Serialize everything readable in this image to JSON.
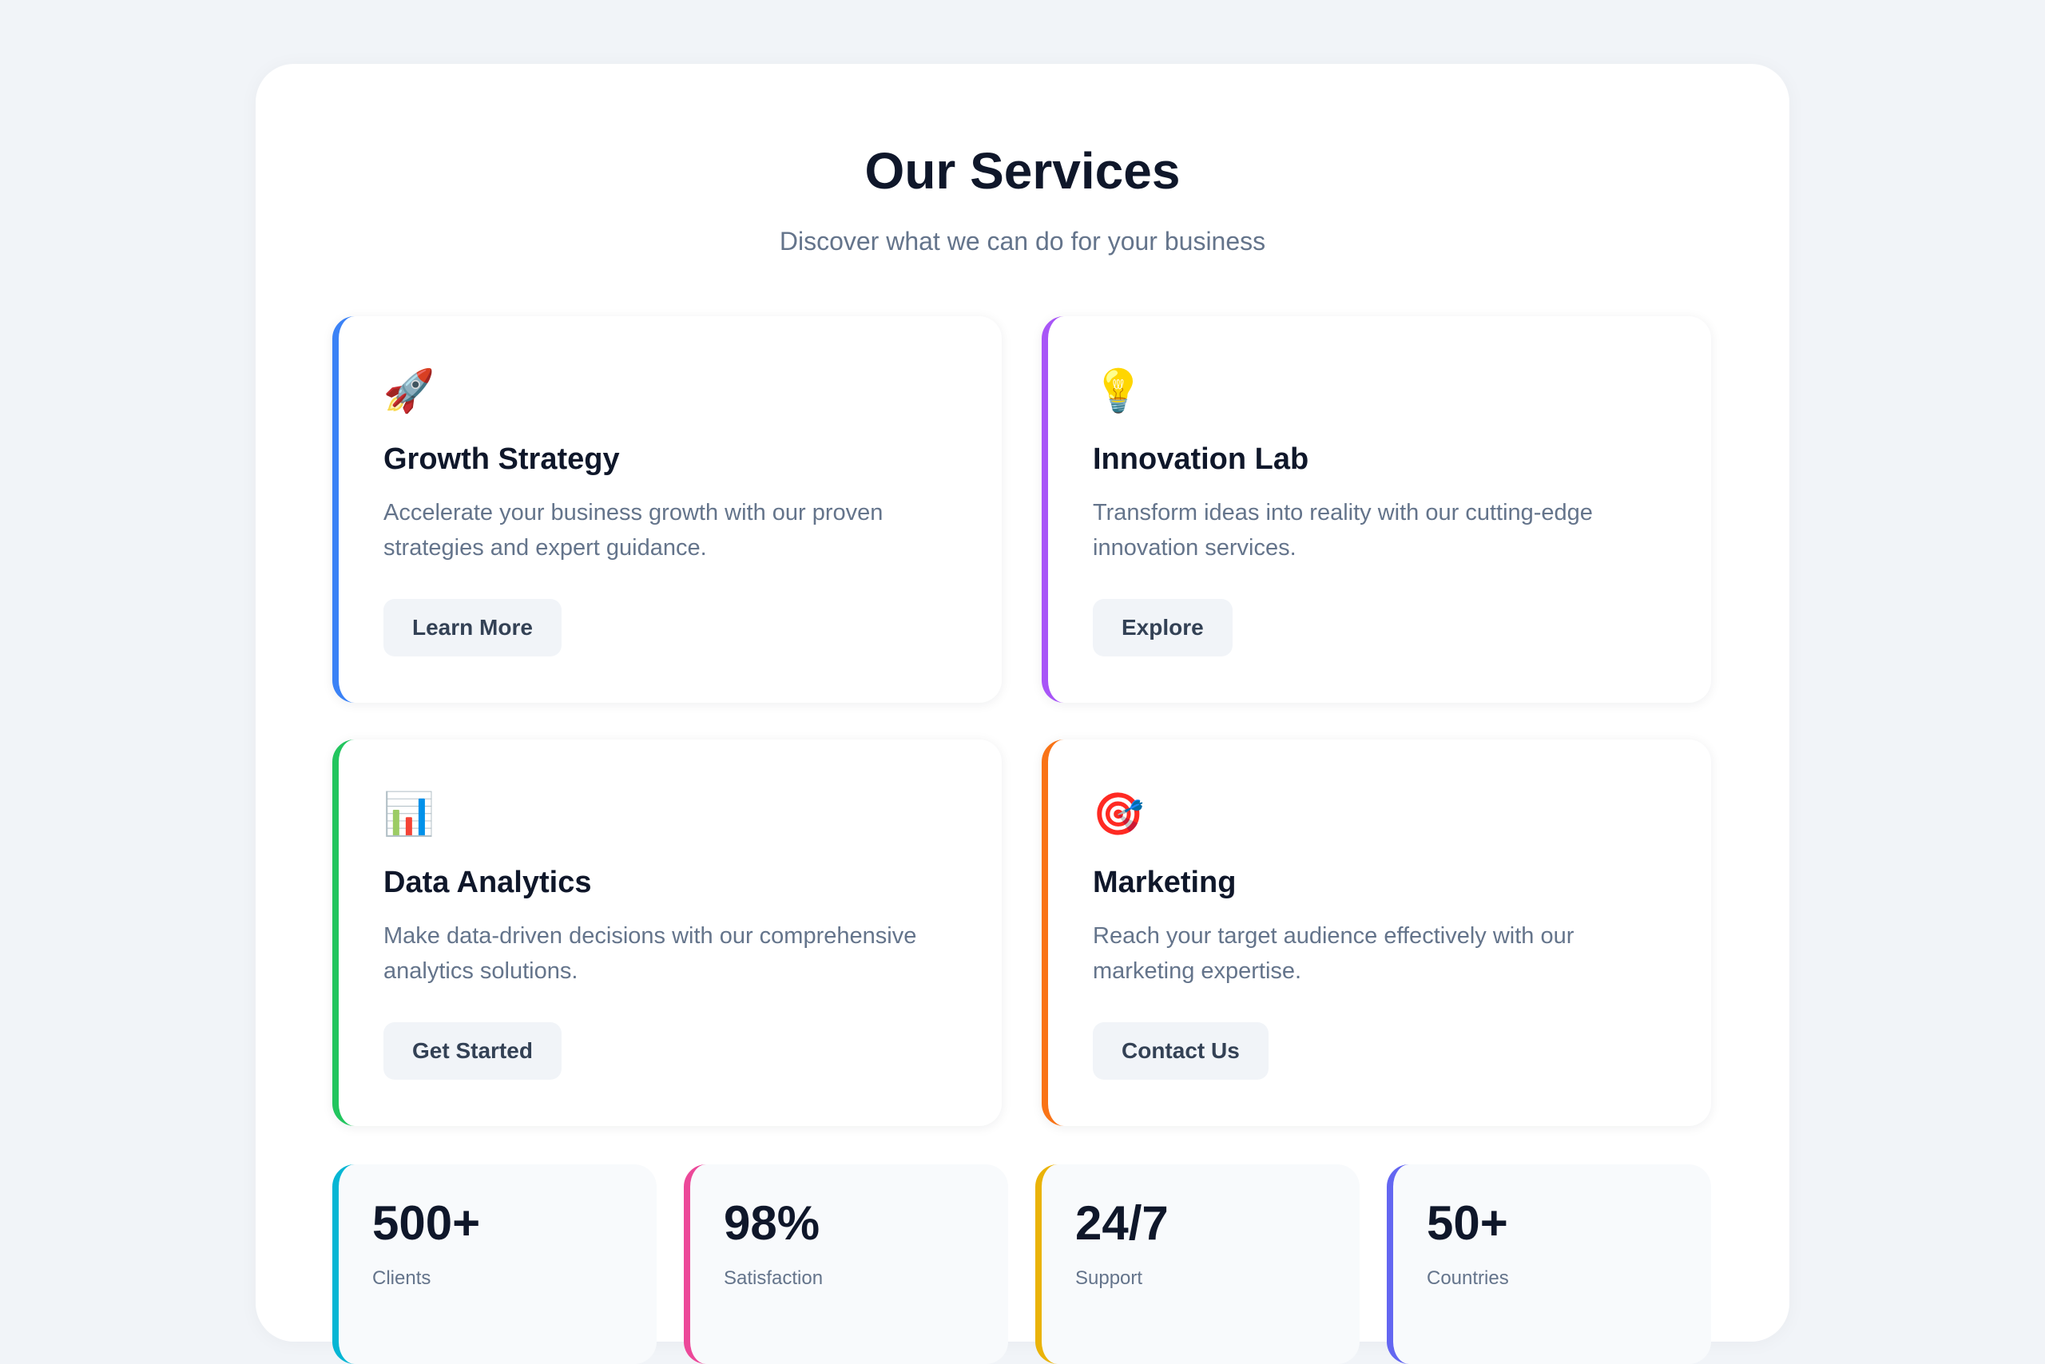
{
  "header": {
    "title": "Our Services",
    "subtitle": "Discover what we can do for your business"
  },
  "services": [
    {
      "icon": "rocket-icon",
      "glyph": "🚀",
      "title": "Growth Strategy",
      "description": "Accelerate your business growth with our proven strategies and expert guidance.",
      "button": "Learn More",
      "accent": "#3b82f6"
    },
    {
      "icon": "lightbulb-icon",
      "glyph": "💡",
      "title": "Innovation Lab",
      "description": "Transform ideas into reality with our cutting-edge innovation services.",
      "button": "Explore",
      "accent": "#a855f7"
    },
    {
      "icon": "bar-chart-icon",
      "glyph": "📊",
      "title": "Data Analytics",
      "description": "Make data-driven decisions with our comprehensive analytics solutions.",
      "button": "Get Started",
      "accent": "#22c55e"
    },
    {
      "icon": "target-icon",
      "glyph": "🎯",
      "title": "Marketing",
      "description": "Reach your target audience effectively with our marketing expertise.",
      "button": "Contact Us",
      "accent": "#f97316"
    }
  ],
  "stats": [
    {
      "value": "500+",
      "label": "Clients",
      "accent": "#06b6d4"
    },
    {
      "value": "98%",
      "label": "Satisfaction",
      "accent": "#ec4899"
    },
    {
      "value": "24/7",
      "label": "Support",
      "accent": "#eab308"
    },
    {
      "value": "50+",
      "label": "Countries",
      "accent": "#6366f1"
    }
  ]
}
